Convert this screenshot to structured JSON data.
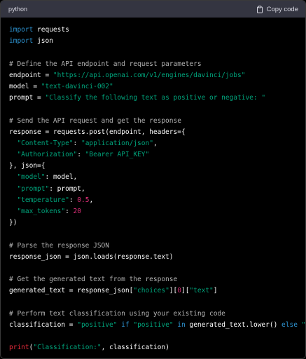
{
  "header": {
    "language": "python",
    "copy_label": "Copy code",
    "copy_icon": "clipboard-icon"
  },
  "colors": {
    "background": "#000000",
    "header": "#343541",
    "keyword": "#2e95d3",
    "string": "#00a67d",
    "number": "#df3079",
    "comment": "#b4b4b4",
    "builtin": "#f22c3d"
  },
  "code_lines": [
    [
      {
        "t": "kw",
        "v": "import"
      },
      {
        "t": "pl",
        "v": " requests"
      }
    ],
    [
      {
        "t": "kw",
        "v": "import"
      },
      {
        "t": "pl",
        "v": " json"
      }
    ],
    [],
    [
      {
        "t": "cm",
        "v": "# Define the API endpoint and request parameters"
      }
    ],
    [
      {
        "t": "pl",
        "v": "endpoint = "
      },
      {
        "t": "str",
        "v": "\"https://api.openai.com/v1/engines/davinci/jobs\""
      }
    ],
    [
      {
        "t": "pl",
        "v": "model = "
      },
      {
        "t": "str",
        "v": "\"text-davinci-002\""
      }
    ],
    [
      {
        "t": "pl",
        "v": "prompt = "
      },
      {
        "t": "str",
        "v": "\"Classify the following text as positive or negative: \""
      }
    ],
    [],
    [
      {
        "t": "cm",
        "v": "# Send the API request and get the response"
      }
    ],
    [
      {
        "t": "pl",
        "v": "response = requests.post(endpoint, headers={"
      }
    ],
    [
      {
        "t": "pl",
        "v": "  "
      },
      {
        "t": "str",
        "v": "\"Content-Type\""
      },
      {
        "t": "pl",
        "v": ": "
      },
      {
        "t": "str",
        "v": "\"application/json\""
      },
      {
        "t": "pl",
        "v": ","
      }
    ],
    [
      {
        "t": "pl",
        "v": "  "
      },
      {
        "t": "str",
        "v": "\"Authorization\""
      },
      {
        "t": "pl",
        "v": ": "
      },
      {
        "t": "str",
        "v": "\"Bearer API_KEY\""
      }
    ],
    [
      {
        "t": "pl",
        "v": "}, json={"
      }
    ],
    [
      {
        "t": "pl",
        "v": "  "
      },
      {
        "t": "str",
        "v": "\"model\""
      },
      {
        "t": "pl",
        "v": ": model,"
      }
    ],
    [
      {
        "t": "pl",
        "v": "  "
      },
      {
        "t": "str",
        "v": "\"prompt\""
      },
      {
        "t": "pl",
        "v": ": prompt,"
      }
    ],
    [
      {
        "t": "pl",
        "v": "  "
      },
      {
        "t": "str",
        "v": "\"temperature\""
      },
      {
        "t": "pl",
        "v": ": "
      },
      {
        "t": "num",
        "v": "0.5"
      },
      {
        "t": "pl",
        "v": ","
      }
    ],
    [
      {
        "t": "pl",
        "v": "  "
      },
      {
        "t": "str",
        "v": "\"max_tokens\""
      },
      {
        "t": "pl",
        "v": ": "
      },
      {
        "t": "num",
        "v": "20"
      }
    ],
    [
      {
        "t": "pl",
        "v": "})"
      }
    ],
    [],
    [
      {
        "t": "cm",
        "v": "# Parse the response JSON"
      }
    ],
    [
      {
        "t": "pl",
        "v": "response_json = json.loads(response.text)"
      }
    ],
    [],
    [
      {
        "t": "cm",
        "v": "# Get the generated text from the response"
      }
    ],
    [
      {
        "t": "pl",
        "v": "generated_text = response_json["
      },
      {
        "t": "str",
        "v": "\"choices\""
      },
      {
        "t": "pl",
        "v": "]["
      },
      {
        "t": "num",
        "v": "0"
      },
      {
        "t": "pl",
        "v": "]["
      },
      {
        "t": "str",
        "v": "\"text\""
      },
      {
        "t": "pl",
        "v": "]"
      }
    ],
    [],
    [
      {
        "t": "cm",
        "v": "# Perform text classification using your existing code"
      }
    ],
    [
      {
        "t": "pl",
        "v": "classification = "
      },
      {
        "t": "str",
        "v": "\"positive\""
      },
      {
        "t": "pl",
        "v": " "
      },
      {
        "t": "kw",
        "v": "if"
      },
      {
        "t": "pl",
        "v": " "
      },
      {
        "t": "str",
        "v": "\"positive\""
      },
      {
        "t": "pl",
        "v": " "
      },
      {
        "t": "kw",
        "v": "in"
      },
      {
        "t": "pl",
        "v": " generated_text.lower() "
      },
      {
        "t": "kw",
        "v": "else"
      },
      {
        "t": "pl",
        "v": " "
      },
      {
        "t": "str",
        "v": "\"negative\""
      }
    ],
    [],
    [
      {
        "t": "fn",
        "v": "print"
      },
      {
        "t": "pl",
        "v": "("
      },
      {
        "t": "str",
        "v": "\"Classification:\""
      },
      {
        "t": "pl",
        "v": ", classification)"
      }
    ]
  ]
}
